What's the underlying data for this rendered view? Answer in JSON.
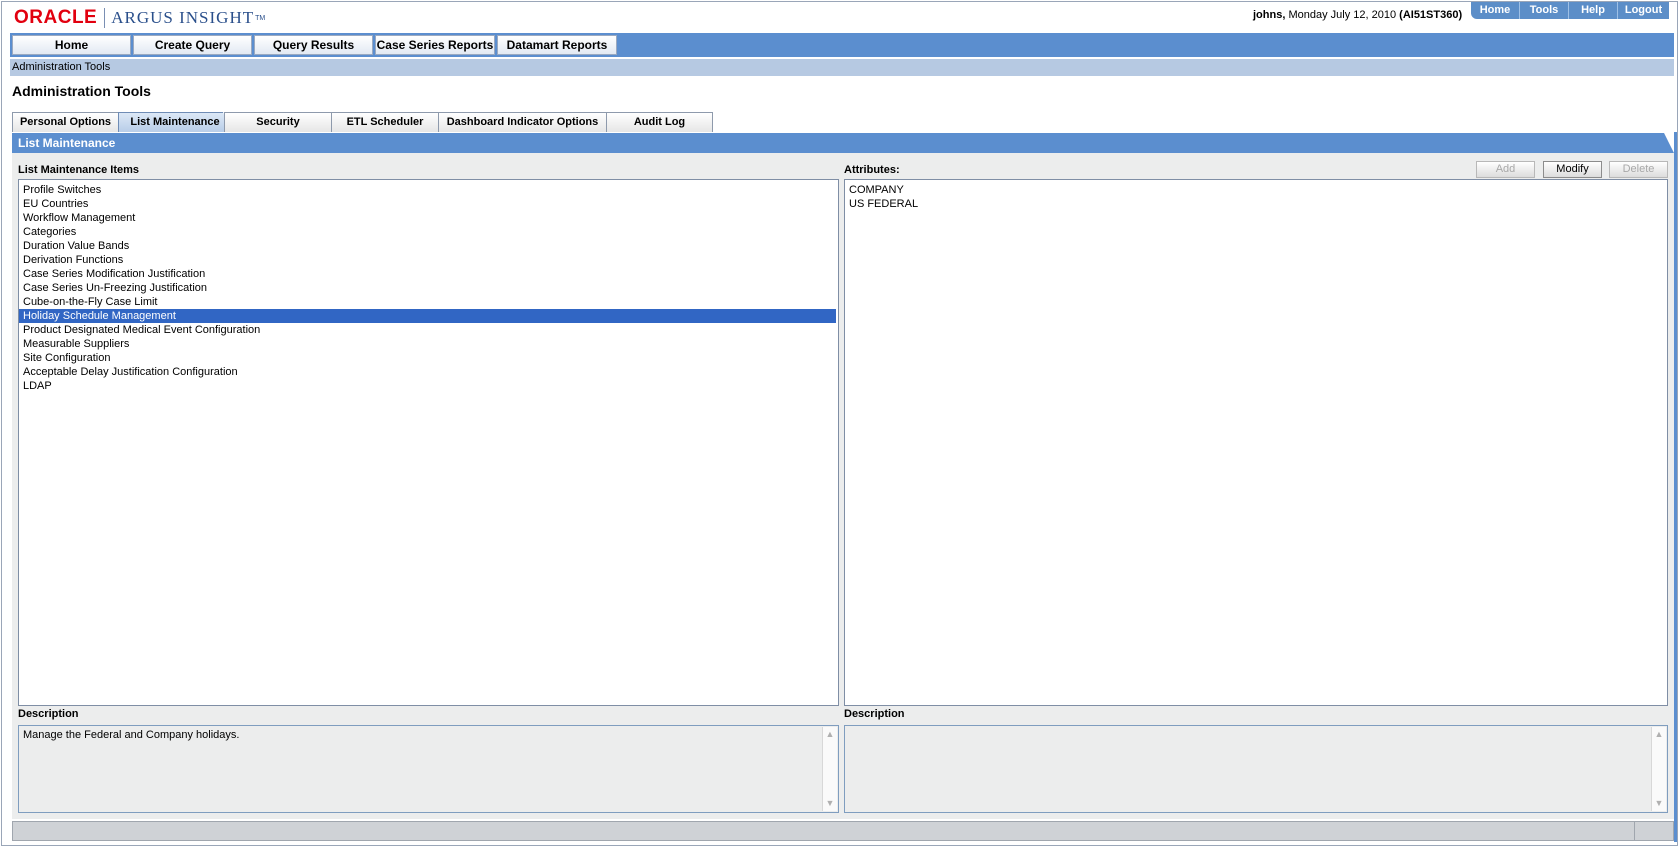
{
  "app": {
    "logo_oracle": "ORACLE",
    "logo_product": "ARGUS INSIGHT",
    "logo_tm": "TM"
  },
  "user": {
    "username": "johns,",
    "date": "Monday July 12, 2010",
    "instance": "(AI51ST360)"
  },
  "util_nav": [
    "Home",
    "Tools",
    "Help",
    "Logout"
  ],
  "main_nav": [
    "Home",
    "Create Query",
    "Query Results",
    "Case Series Reports",
    "Datamart Reports"
  ],
  "breadcrumb": "Administration Tools",
  "page_title": "Administration Tools",
  "tabs": [
    {
      "label": "Personal Options",
      "active": false
    },
    {
      "label": "List Maintenance",
      "active": true
    },
    {
      "label": "Security",
      "active": false
    },
    {
      "label": "ETL Scheduler",
      "active": false
    },
    {
      "label": "Dashboard Indicator Options",
      "active": false
    },
    {
      "label": "Audit Log",
      "active": false
    }
  ],
  "section_title": "List Maintenance",
  "left_panel": {
    "label": "List Maintenance Items",
    "items": [
      "Profile Switches",
      "EU Countries",
      "Workflow Management",
      "Categories",
      "Duration Value Bands",
      "Derivation Functions",
      "Case Series Modification Justification",
      "Case Series Un-Freezing Justification",
      "Cube-on-the-Fly Case Limit",
      "Holiday Schedule Management",
      "Product Designated Medical Event Configuration",
      "Measurable Suppliers",
      "Site Configuration",
      "Acceptable Delay Justification Configuration",
      "LDAP"
    ],
    "selected_item": "Holiday Schedule Management",
    "description_label": "Description",
    "description": "Manage the Federal and Company holidays."
  },
  "right_panel": {
    "label": "Attributes:",
    "buttons": {
      "add": "Add",
      "modify": "Modify",
      "delete": "Delete"
    },
    "items": [
      "COMPANY",
      "US FEDERAL"
    ],
    "description_label": "Description",
    "description": ""
  },
  "colors": {
    "nav_blue": "#5b8ecf",
    "breadcrumb_blue": "#b6c9e2",
    "selection_blue": "#3166c4",
    "oracle_red": "#e2000f"
  }
}
